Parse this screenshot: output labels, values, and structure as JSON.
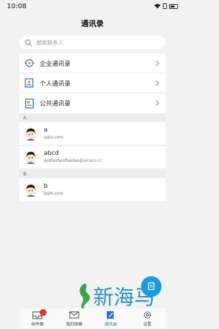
{
  "status_bar": {
    "time": "10:08"
  },
  "header": {
    "title": "通讯录"
  },
  "search": {
    "placeholder": "搜索联系人"
  },
  "directory_menu": [
    {
      "label": "企业通讯录",
      "icon": "enterprise-contacts-icon"
    },
    {
      "label": "个人通讯录",
      "icon": "personal-contacts-icon"
    },
    {
      "label": "公共通讯录",
      "icon": "public-contacts-icon"
    }
  ],
  "sections": [
    {
      "letter": "A",
      "contacts": [
        {
          "name": "a",
          "email": "a@a.com"
        },
        {
          "name": "abcd",
          "email": "asdfasfasdfasdas@aicoco.cc"
        }
      ]
    },
    {
      "letter": "B",
      "contacts": [
        {
          "name": "b",
          "email": "b@b.com"
        }
      ]
    }
  ],
  "tabbar": {
    "tabs": [
      {
        "label": "收件箱",
        "icon": "inbox-icon",
        "badge": ""
      },
      {
        "label": "我的邮箱",
        "icon": "mailbox-icon"
      },
      {
        "label": "通讯录",
        "icon": "contacts-pen-icon",
        "active": true
      },
      {
        "label": "设置",
        "icon": "settings-gear-icon"
      }
    ]
  },
  "watermark": {
    "text": "新海马"
  },
  "colors": {
    "accent": "#1f6fe0",
    "fab": "#1a9cde",
    "badge": "#e53030",
    "watermark": "#2a8fd0"
  }
}
